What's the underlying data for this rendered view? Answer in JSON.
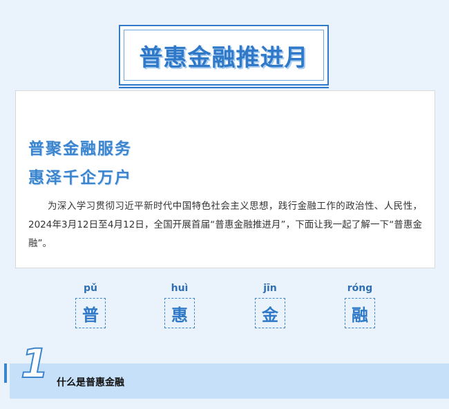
{
  "page_title": "普惠金融推进月",
  "intro": {
    "headline_1": "普聚金融服务",
    "headline_2": "惠泽千企万户",
    "body": "为深入学习贯彻习近平新时代中国特色社会主义思想，践行金融工作的政治性、人民性，2024年3月12日至4月12日，全国开展首届“普惠金融推进月”，下面让我一起了解一下“普惠金融”。"
  },
  "pinyin": [
    {
      "py": "pǔ",
      "char": "普"
    },
    {
      "py": "huì",
      "char": "惠"
    },
    {
      "py": "jīn",
      "char": "金"
    },
    {
      "py": "róng",
      "char": "融"
    }
  ],
  "section": {
    "number": "1",
    "title": "什么是普惠金融"
  }
}
